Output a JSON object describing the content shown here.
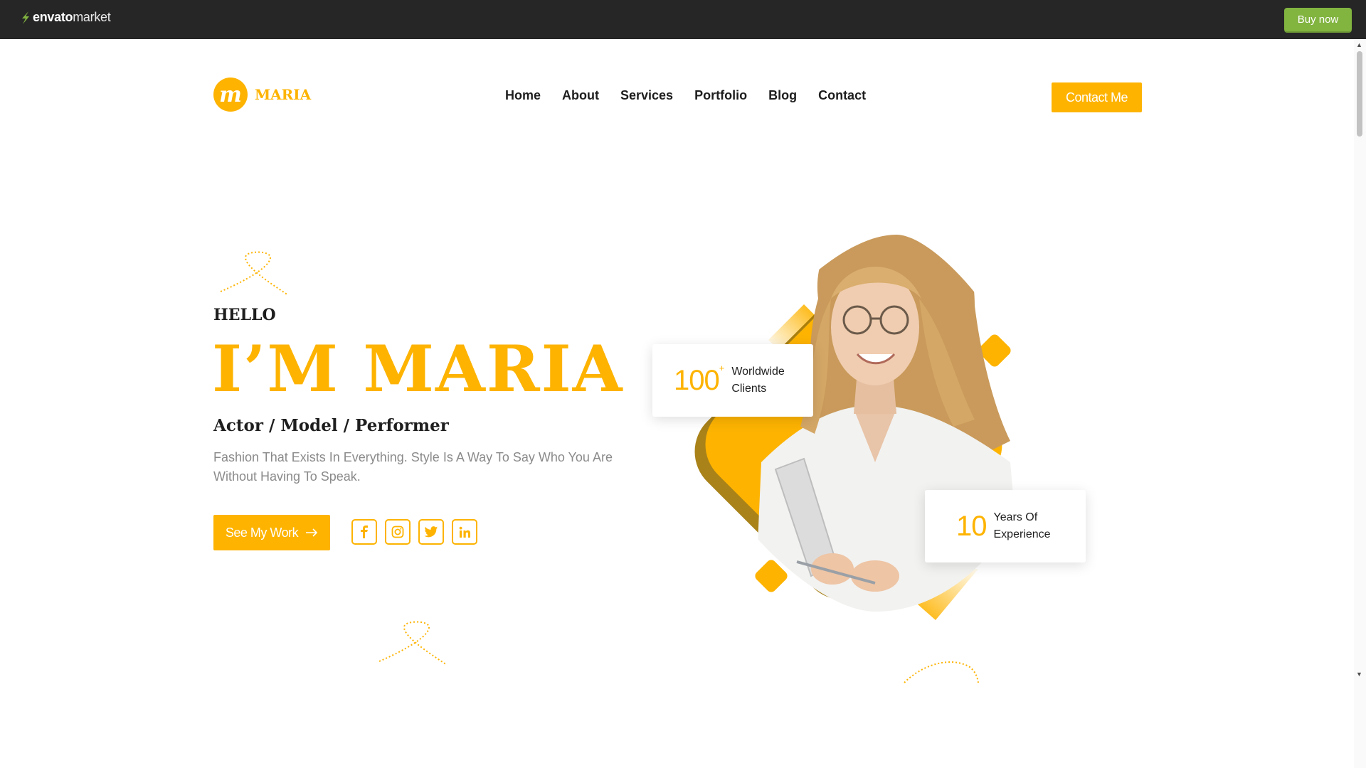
{
  "envato": {
    "brand": "envato",
    "market": "market",
    "buy_label": "Buy now"
  },
  "site": {
    "logo_letter": "m",
    "logo_text": "MARIA",
    "nav": [
      "Home",
      "About",
      "Services",
      "Portfolio",
      "Blog",
      "Contact"
    ],
    "contact_button": "Contact Me"
  },
  "hero": {
    "greeting": "HELLO",
    "title": "I’M MARIA",
    "roles": "Actor / Model / Performer",
    "tagline": "Fashion That Exists In Everything. Style Is A Way To Say Who You Are Without Having To Speak.",
    "cta": "See My Work",
    "socials": [
      "facebook-icon",
      "instagram-icon",
      "twitter-icon",
      "linkedin-icon"
    ]
  },
  "stats": {
    "clients_number": "100",
    "clients_plus": "+",
    "clients_label_1": "Worldwide",
    "clients_label_2": "Clients",
    "years_number": "10",
    "years_label_1": "Years Of",
    "years_label_2": "Experience"
  },
  "colors": {
    "accent": "#fdb300",
    "envato_bar": "#262626",
    "buy_green": "#82b440",
    "text_dark": "#1e1e1e",
    "text_muted": "#8a8a8a"
  }
}
